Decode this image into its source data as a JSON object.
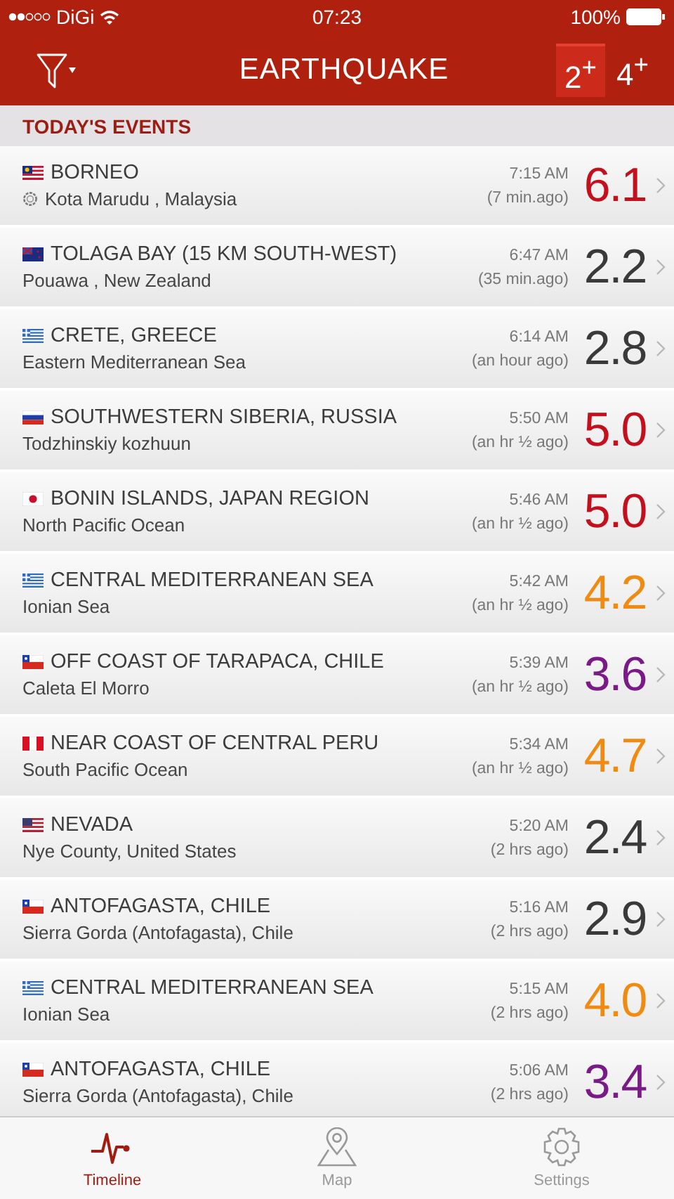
{
  "status_bar": {
    "carrier": "DiGi",
    "time": "07:23",
    "battery": "100%"
  },
  "nav": {
    "title": "EARTHQUAKE",
    "filters": [
      {
        "label": "2$^{+}$",
        "selected": true
      },
      {
        "label": "4$^{+}$",
        "selected": false
      }
    ]
  },
  "section": "TODAY'S EVENTS",
  "events": [
    {
      "kind": "my",
      "title": "BORNEO",
      "place": "Kota Marudu , Malaysia",
      "ring_icon": true,
      "time": "7:15 AM",
      "ago": "(7 min.ago)",
      "magnitude": "6.1",
      "color": "#c4101c"
    },
    {
      "kind": "nz",
      "title": "TOLAGA BAY (15 KM SOUTH-WEST)",
      "place": "Pouawa , New Zealand",
      "ring_icon": false,
      "time": "6:47 AM",
      "ago": "(35 min.ago)",
      "magnitude": "2.2",
      "color": "#3a3a3a"
    },
    {
      "kind": "gr",
      "title": "CRETE, GREECE",
      "place": "Eastern Mediterranean Sea",
      "ring_icon": false,
      "time": "6:14 AM",
      "ago": "(an hour ago)",
      "magnitude": "2.8",
      "color": "#3a3a3a"
    },
    {
      "kind": "ru",
      "title": "SOUTHWESTERN SIBERIA, RUSSIA",
      "place": "Todzhinskiy kozhuun",
      "ring_icon": false,
      "time": "5:50 AM",
      "ago": "(an hr ½ ago)",
      "magnitude": "5.0",
      "color": "#c4101c"
    },
    {
      "kind": "jp",
      "title": "BONIN ISLANDS, JAPAN REGION",
      "place": "North Pacific Ocean",
      "ring_icon": false,
      "time": "5:46 AM",
      "ago": "(an hr ½ ago)",
      "magnitude": "5.0",
      "color": "#c4101c"
    },
    {
      "kind": "gr",
      "title": "CENTRAL MEDITERRANEAN SEA",
      "place": "Ionian Sea",
      "ring_icon": false,
      "time": "5:42 AM",
      "ago": "(an hr ½ ago)",
      "magnitude": "4.2",
      "color": "#f08a10"
    },
    {
      "kind": "cl",
      "title": "OFF COAST OF TARAPACA, CHILE",
      "place": "Caleta El Morro",
      "ring_icon": false,
      "time": "5:39 AM",
      "ago": "(an hr ½ ago)",
      "magnitude": "3.6",
      "color": "#7a1a86"
    },
    {
      "kind": "pe",
      "title": "NEAR COAST OF CENTRAL PERU",
      "place": "South Pacific Ocean",
      "ring_icon": false,
      "time": "5:34 AM",
      "ago": "(an hr ½ ago)",
      "magnitude": "4.7",
      "color": "#f08a10"
    },
    {
      "kind": "us",
      "title": "NEVADA",
      "place": "Nye County, United States",
      "ring_icon": false,
      "time": "5:20 AM",
      "ago": "(2 hrs ago)",
      "magnitude": "2.4",
      "color": "#3a3a3a"
    },
    {
      "kind": "cl",
      "title": "ANTOFAGASTA, CHILE",
      "place": "Sierra Gorda (Antofagasta), Chile",
      "ring_icon": false,
      "time": "5:16 AM",
      "ago": "(2 hrs ago)",
      "magnitude": "2.9",
      "color": "#3a3a3a"
    },
    {
      "kind": "gr",
      "title": "CENTRAL MEDITERRANEAN SEA",
      "place": "Ionian Sea",
      "ring_icon": false,
      "time": "5:15 AM",
      "ago": "(2 hrs ago)",
      "magnitude": "4.0",
      "color": "#f08a10"
    },
    {
      "kind": "cl",
      "title": "ANTOFAGASTA, CHILE",
      "place": "Sierra Gorda (Antofagasta), Chile",
      "ring_icon": false,
      "time": "5:06 AM",
      "ago": "(2 hrs ago)",
      "magnitude": "3.4",
      "color": "#7a1a86"
    }
  ],
  "tabs": [
    {
      "kind": "timeline",
      "label": "Timeline",
      "selected": true
    },
    {
      "kind": "map",
      "label": "Map",
      "selected": false
    },
    {
      "kind": "settings",
      "label": "Settings",
      "selected": false
    }
  ]
}
